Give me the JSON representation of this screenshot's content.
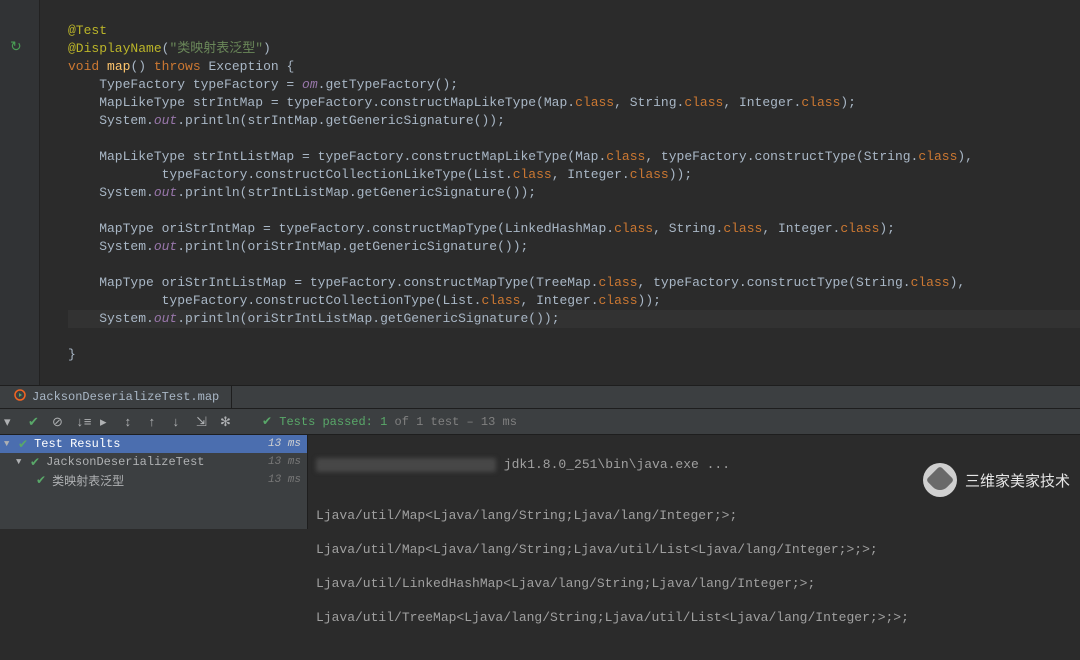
{
  "editor": {
    "l1_anno": "@Test",
    "l2_anno": "@DisplayName",
    "l2_str": "\"类映射表泛型\"",
    "l3_kw_void": "void",
    "l3_name": "map",
    "l3_kw_throws": "throws",
    "l3_ex": "Exception {",
    "l4": "    TypeFactory typeFactory = ",
    "l4_field": "om",
    "l4_tail": ".getTypeFactory();",
    "l5a": "    MapLikeType strIntMap = typeFactory.constructMapLikeType(Map.",
    "l5b": ", String.",
    "l5c": ", Integer.",
    "l5d": ");",
    "l6a": "    System.",
    "l6_out": "out",
    "l6b": ".println(strIntMap.getGenericSignature());",
    "l8a": "    MapLikeType strIntListMap = typeFactory.constructMapLikeType(Map.",
    "l8b": ", typeFactory.constructType(String.",
    "l8c": "),",
    "l9a": "            typeFactory.constructCollectionLikeType(List.",
    "l9b": ", Integer.",
    "l9c": "));",
    "l10": ".println(strIntListMap.getGenericSignature());",
    "l12a": "    MapType oriStrIntMap = typeFactory.constructMapType(LinkedHashMap.",
    "l12b": ", String.",
    "l12c": ", Integer.",
    "l12d": ");",
    "l13": ".println(oriStrIntMap.getGenericSignature());",
    "l15a": "    MapType oriStrIntListMap = typeFactory.constructMapType(TreeMap.",
    "l15b": ", typeFactory.constructType(String.",
    "l15c": "),",
    "l16a": "            typeFactory.constructCollectionType(List.",
    "l16b": ", Integer.",
    "l16c": "));",
    "l17": ".println(oriStrIntListMap.getGenericSignature());",
    "l18": "}",
    "class_kw": "class"
  },
  "tab": {
    "label": "JacksonDeserializeTest.map"
  },
  "toolbar": {
    "tests_passed_prefix": "Tests passed: ",
    "tests_passed_count": "1",
    "tests_passed_mid": " of 1 test – ",
    "tests_passed_time": "13 ms"
  },
  "tree": {
    "root": {
      "label": "Test Results",
      "time": "13 ms"
    },
    "suite": {
      "label": "JacksonDeserializeTest",
      "time": "13 ms"
    },
    "test": {
      "label": "类映射表泛型",
      "time": "13 ms"
    }
  },
  "console": {
    "jdk": " jdk1.8.0_251\\bin\\java.exe ...",
    "o1": "Ljava/util/Map<Ljava/lang/String;Ljava/lang/Integer;>;",
    "o2": "Ljava/util/Map<Ljava/lang/String;Ljava/util/List<Ljava/lang/Integer;>;>;",
    "o3": "Ljava/util/LinkedHashMap<Ljava/lang/String;Ljava/lang/Integer;>;",
    "o4": "Ljava/util/TreeMap<Ljava/lang/String;Ljava/util/List<Ljava/lang/Integer;>;>;"
  },
  "watermark": "三维家美家技术"
}
